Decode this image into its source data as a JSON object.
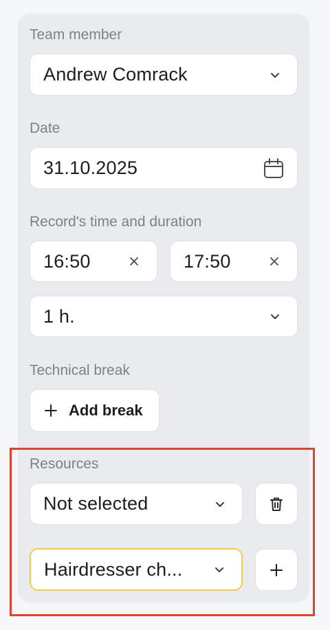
{
  "team_member": {
    "label": "Team member",
    "value": "Andrew Comrack"
  },
  "date": {
    "label": "Date",
    "value": "31.10.2025"
  },
  "record_time": {
    "label": "Record's time and duration",
    "start": "16:50",
    "end": "17:50",
    "duration": "1 h."
  },
  "technical_break": {
    "label": "Technical break",
    "add_button": "Add break"
  },
  "resources": {
    "label": "Resources",
    "items": [
      {
        "value": "Not selected"
      },
      {
        "value": "Hairdresser ch..."
      }
    ]
  },
  "colors": {
    "highlight_border": "#d9442f",
    "selected_border": "#f2cc45",
    "panel_bg": "#e9ebef"
  }
}
